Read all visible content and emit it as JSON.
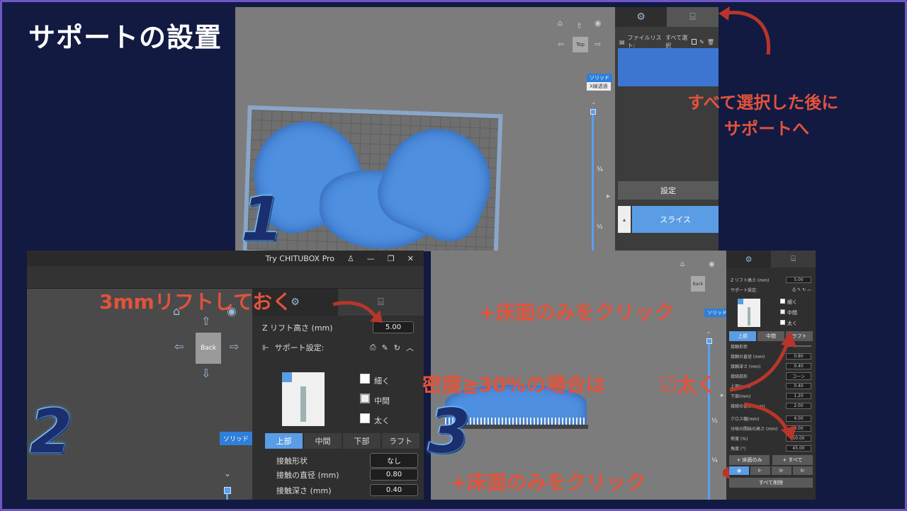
{
  "page": {
    "title": "サポートの設置"
  },
  "colors": {
    "background": "#121a42",
    "accent_blue": "#5b9de4",
    "note_red": "#e2533c",
    "viewport_grey": "#7c7c7c"
  },
  "step_numbers": [
    "1",
    "2",
    "3"
  ],
  "panel1": {
    "file_list_label": "ファイルリスト:",
    "select_all_label": "すべて選択",
    "view_top": "Top",
    "solid_label": "ソリッド",
    "xray_label": "X線透過",
    "settings_button": "設定",
    "slice_button": "スライス",
    "slider_marks": [
      "¾",
      "½"
    ],
    "icons": [
      "gear-icon",
      "support-icon",
      "home-icon",
      "eye-icon",
      "arrow-up-icon",
      "arrow-left-icon",
      "arrow-right-icon",
      "arrow-down-icon",
      "checkbox-icon",
      "edit-icon",
      "trash-icon"
    ]
  },
  "panel2": {
    "window_title": "Try CHITUBOX Pro",
    "view_back": "Back",
    "view_top_partial": "dot",
    "solid_label": "ソリッド",
    "z_lift_label": "Z リフト高さ (mm)",
    "z_lift_value": "5.00",
    "support_settings_label": "サポート設定:",
    "thickness_options": [
      "細く",
      "中間",
      "太く"
    ],
    "selected_thickness": "中間",
    "sub_tabs": [
      "上部",
      "中間",
      "下部",
      "ラフト"
    ],
    "active_sub_tab": "上部",
    "params": [
      {
        "label": "接触形状",
        "value": "なし"
      },
      {
        "label": "接触の直径 (mm)",
        "value": "0.80"
      },
      {
        "label": "接触深さ (mm)",
        "value": "0.40"
      }
    ]
  },
  "panel3": {
    "z_lift_label": "Z リフト高さ (mm)",
    "z_lift_value": "5.00",
    "support_settings_label": "サポート設定:",
    "view_back": "Back",
    "solid_label": "ソリッド",
    "thickness_options": [
      "細く",
      "中間",
      "太く"
    ],
    "sub_tabs": [
      "上部",
      "中間",
      "ラフト"
    ],
    "params": [
      {
        "label": "接触形状",
        "value": ""
      },
      {
        "label": "接触の直径 (mm)",
        "value": "0.80"
      },
      {
        "label": "接触深さ (mm)",
        "value": "0.40"
      },
      {
        "label": "接続部形",
        "value": "コーン"
      },
      {
        "label": "上部(mm)",
        "value": "0.40"
      },
      {
        "label": "下部(mm)",
        "value": "1.20"
      },
      {
        "label": "接続の長さ (mm)",
        "value": "2.00"
      },
      {
        "label": "クロス幅(mm)",
        "value": "4.00"
      },
      {
        "label": "分岐の開始の高さ (mm)",
        "value": "0.00"
      },
      {
        "label": "密度 (%)",
        "value": "50.00"
      },
      {
        "label": "角度 (°)",
        "value": "45.00"
      }
    ],
    "platform_only_button": "+ 床面のみ",
    "all_button": "+ すべて",
    "delete_all_button": "すべて削除",
    "slider_marks": [
      "½",
      "¼"
    ]
  },
  "notes": {
    "after_select_all_line1": "すべて選択した後に",
    "after_select_all_line2": "サポートへ",
    "lift_3mm": "3mmリフトしておく",
    "click_platform_top": "+床面のみをクリック",
    "density_note": "密度≧30%の場合は",
    "thick_check": "☑太く",
    "click_platform_bottom": "+床面のみをクリック"
  }
}
